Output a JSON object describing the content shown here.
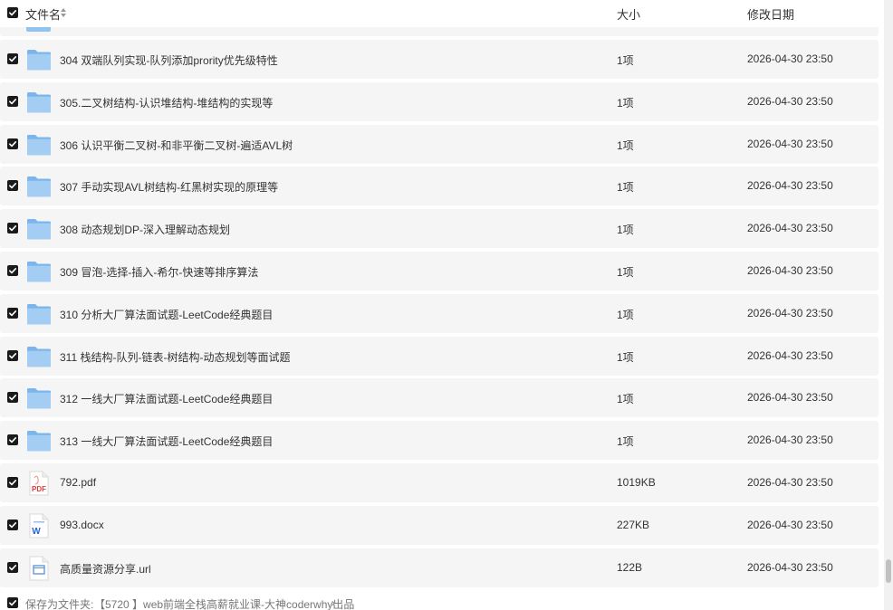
{
  "header": {
    "col_name": "文件名",
    "col_size": "大小",
    "col_date": "修改日期"
  },
  "files": [
    {
      "type": "folder-icon",
      "name": "304 双端队列实现-队列添加prority优先级特性",
      "size": "1项",
      "date": "2026-04-30 23:50"
    },
    {
      "type": "folder-icon",
      "name": "305.二叉树结构-认识堆结构-堆结构的实现等",
      "size": "1项",
      "date": "2026-04-30 23:50"
    },
    {
      "type": "folder-icon",
      "name": "306 认识平衡二叉树-和非平衡二叉树-遍适AVL树",
      "size": "1项",
      "date": "2026-04-30 23:50"
    },
    {
      "type": "folder-icon",
      "name": "307 手动实现AVL树结构-红黑树实现的原理等",
      "size": "1项",
      "date": "2026-04-30 23:50"
    },
    {
      "type": "folder-icon",
      "name": "308 动态规划DP-深入理解动态规划",
      "size": "1项",
      "date": "2026-04-30 23:50"
    },
    {
      "type": "folder-icon",
      "name": "309 冒泡-选择-插入-希尔-快速等排序算法",
      "size": "1项",
      "date": "2026-04-30 23:50"
    },
    {
      "type": "folder-icon",
      "name": "310 分析大厂算法面试题-LeetCode经典题目",
      "size": "1项",
      "date": "2026-04-30 23:50"
    },
    {
      "type": "folder-icon",
      "name": "311 栈结构-队列-链表-树结构-动态规划等面试题",
      "size": "1项",
      "date": "2026-04-30 23:50"
    },
    {
      "type": "folder-icon",
      "name": "312 一线大厂算法面试题-LeetCode经典题目",
      "size": "1项",
      "date": "2026-04-30 23:50"
    },
    {
      "type": "folder-icon",
      "name": "313 一线大厂算法面试题-LeetCode经典题目",
      "size": "1项",
      "date": "2026-04-30 23:50"
    },
    {
      "type": "pdf-icon",
      "name": "792.pdf",
      "size": "1019KB",
      "date": "2026-04-30 23:50"
    },
    {
      "type": "docx-icon",
      "name": "993.docx",
      "size": "227KB",
      "date": "2026-04-30 23:50"
    },
    {
      "type": "url-icon",
      "name": "高质量资源分享.url",
      "size": "122B",
      "date": "2026-04-30 23:50"
    }
  ],
  "icon_labels": {
    "pdf": "PDF",
    "docx": "W"
  },
  "footer": {
    "save_label": "保存为文件夹:",
    "save_path": "【5720 】web前端全栈高薪就业课-大神coderwhy出品",
    "chevron": "›"
  },
  "colors": {
    "row_bg": "#f5f5f6",
    "checkbox": "#1a1a1a",
    "folder": "#8fc3f0",
    "pdf_red": "#e53935",
    "word_blue": "#2b63d9"
  }
}
